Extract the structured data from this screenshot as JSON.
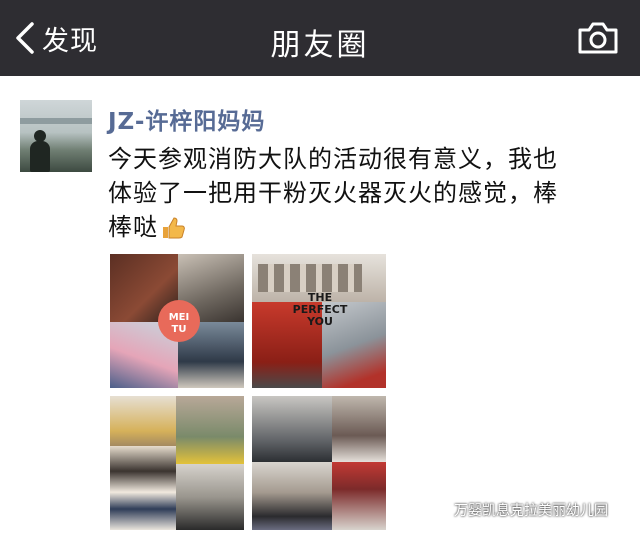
{
  "navbar": {
    "back_label": "发现",
    "title": "朋友圈"
  },
  "post": {
    "author": "JZ-许梓阳妈妈",
    "text_lines": [
      "今天参观消防大队的活动很有意义，我也",
      "体验了一把用干粉灭火器灭火的感觉，棒",
      "棒哒"
    ],
    "emoji": "thumbs-up-icon",
    "photos": [
      {
        "overlay": "MEI\nTU"
      },
      {
        "overlay": "THE\nPERFECT\nYOU"
      },
      {
        "overlay": ""
      },
      {
        "overlay": ""
      }
    ]
  },
  "watermark": {
    "text": "万婴凯息克拉美丽幼儿园"
  },
  "colors": {
    "navbar_bg": "#2e2d32",
    "author_link": "#576b95",
    "text": "#111111"
  }
}
